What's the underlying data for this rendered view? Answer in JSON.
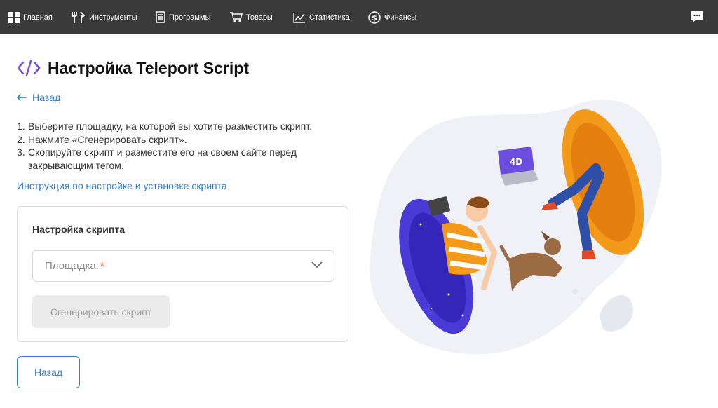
{
  "nav": {
    "items": [
      {
        "label": "Главная",
        "icon": "grid-icon"
      },
      {
        "label": "Инструменты",
        "icon": "tools-icon"
      },
      {
        "label": "Программы",
        "icon": "document-icon"
      },
      {
        "label": "Товары",
        "icon": "cart-icon"
      },
      {
        "label": "Статистика",
        "icon": "chart-line-icon"
      },
      {
        "label": "Финансы",
        "icon": "dollar-circle-icon"
      }
    ],
    "chat_icon": "chat-bubble-icon"
  },
  "page": {
    "title": "Настройка Teleport Script",
    "title_icon": "code-icon",
    "back_link": "Назад",
    "steps": [
      {
        "num": "1.",
        "text": "Выберите площадку, на которой вы хотите разместить скрипт."
      },
      {
        "num": "2.",
        "text": "Нажмите «Сгенерировать скрипт»."
      },
      {
        "num": "3.",
        "text": "Скопируйте скрипт и разместите его на своем сайте перед закрывающим тегом."
      }
    ],
    "instructions_link": "Инструкция по настройке и установке скрипта"
  },
  "card": {
    "title": "Настройка скрипта",
    "platform_select": {
      "label": "Площадка:",
      "required_mark": "*",
      "value": ""
    },
    "generate_button": "Сгенерировать скрипт"
  },
  "footer": {
    "back_button": "Назад"
  },
  "colors": {
    "topbar": "#3a3a3a",
    "link": "#2f7fd6",
    "accent_purple": "#7b4fe0",
    "required": "#e8613c",
    "disabled_bg": "#ebebeb"
  }
}
